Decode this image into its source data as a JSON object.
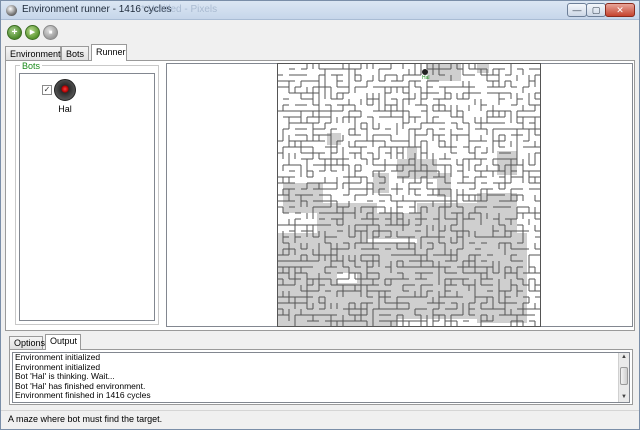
{
  "window": {
    "title": "Environment runner - 1416  cycles",
    "ghost_title": "* Untitled - Pixels",
    "minimize_glyph": "—",
    "maximize_glyph": "▢",
    "close_glyph": "✕"
  },
  "toolbar": {
    "add_icon": "add-circle-icon",
    "play_icon": "play-icon",
    "stop_icon": "stop-icon",
    "add_glyph": "+",
    "play_glyph": "▶",
    "stop_glyph": "■"
  },
  "tabs_top": [
    {
      "label": "Environments",
      "active": false
    },
    {
      "label": "Bots",
      "active": false
    },
    {
      "label": "Runner",
      "active": true
    }
  ],
  "bots_panel": {
    "legend": "Bots",
    "bots": [
      {
        "name": "Hal",
        "checked": true,
        "check_glyph": "✓"
      }
    ]
  },
  "maze": {
    "bot_label": "Hal"
  },
  "tabs_bottom": [
    {
      "label": "Options",
      "active": false
    },
    {
      "label": "Output",
      "active": true
    }
  ],
  "output": {
    "lines": [
      "Environment initialized",
      "Environment initialized",
      "Bot 'Hal' is thinking. Wait...",
      "Bot 'Hal' has finished environment.",
      "Environment finished in 1416 cycles"
    ],
    "scroll_up": "▲",
    "scroll_down": "▼"
  },
  "status": {
    "text": "A maze where bot must find the target."
  },
  "colors": {
    "legend_green": "#1a8a1a",
    "visited_gray": "#cfcfcf",
    "wall": "#555555"
  }
}
